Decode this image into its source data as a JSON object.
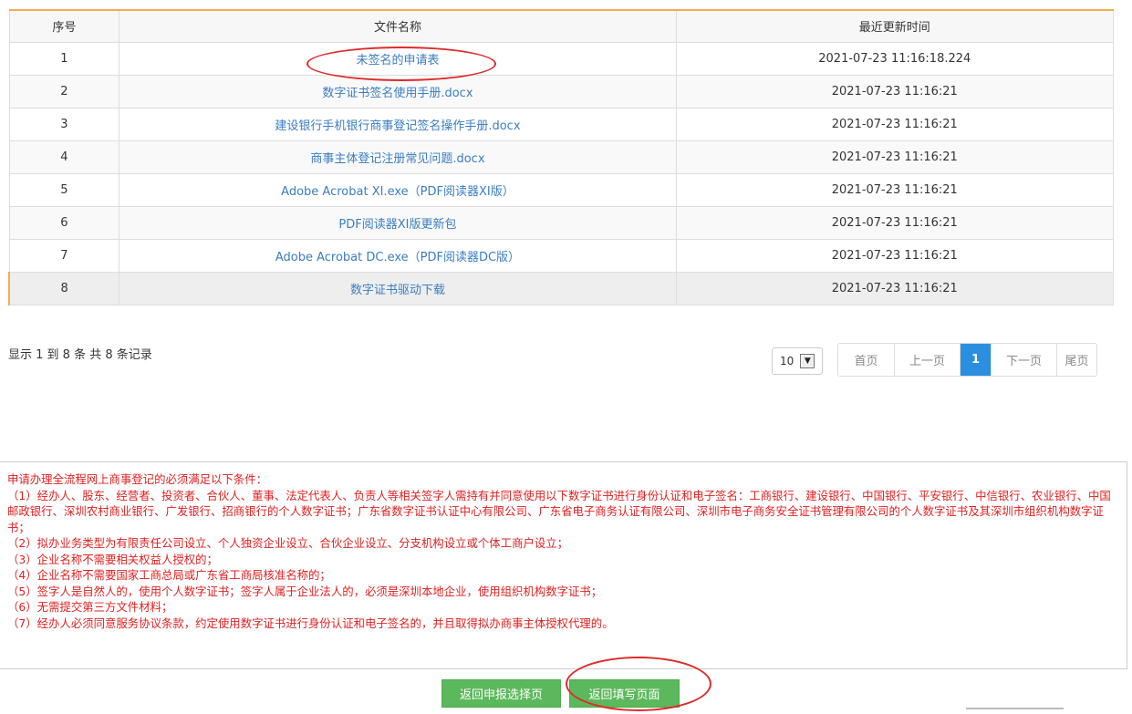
{
  "table": {
    "headers": [
      "序号",
      "文件名称",
      "最近更新时间"
    ],
    "rows": [
      {
        "index": "1",
        "name": "未签名的申请表",
        "time": "2021-07-23 11:16:18.224"
      },
      {
        "index": "2",
        "name": "数字证书签名使用手册.docx",
        "time": "2021-07-23 11:16:21"
      },
      {
        "index": "3",
        "name": "建设银行手机银行商事登记签名操作手册.docx",
        "time": "2021-07-23 11:16:21"
      },
      {
        "index": "4",
        "name": "商事主体登记注册常见问题.docx",
        "time": "2021-07-23 11:16:21"
      },
      {
        "index": "5",
        "name": "Adobe Acrobat XI.exe（PDF阅读器XI版）",
        "time": "2021-07-23 11:16:21"
      },
      {
        "index": "6",
        "name": "PDF阅读器XI版更新包",
        "time": "2021-07-23 11:16:21"
      },
      {
        "index": "7",
        "name": "Adobe Acrobat DC.exe（PDF阅读器DC版）",
        "time": "2021-07-23 11:16:21"
      },
      {
        "index": "8",
        "name": "数字证书驱动下载",
        "time": "2021-07-23 11:16:21"
      }
    ]
  },
  "pagination": {
    "info": "显示 1 到 8 条 共 8 条记录",
    "page_size": "10",
    "first": "首页",
    "prev": "上一页",
    "current": "1",
    "next": "下一页",
    "last": "尾页"
  },
  "notice": {
    "lines": [
      "申请办理全流程网上商事登记的必须满足以下条件：",
      "（1）经办人、股东、经营者、投资者、合伙人、董事、法定代表人、负责人等相关签字人需持有并同意使用以下数字证书进行身份认证和电子签名：工商银行、建设银行、中国银行、平安银行、中信银行、农业银行、中国邮政银行、深圳农村商业银行、广发银行、招商银行的个人数字证书；广东省数字证书认证中心有限公司、广东省电子商务认证有限公司、深圳市电子商务安全证书管理有限公司的个人数字证书及其深圳市组织机构数字证书；",
      "（2）拟办业务类型为有限责任公司设立、个人独资企业设立、合伙企业设立、分支机构设立或个体工商户设立；",
      "（3）企业名称不需要相关权益人授权的；",
      "（4）企业名称不需要国家工商总局或广东省工商局核准名称的；",
      "（5）签字人是自然人的，使用个人数字证书；签字人属于企业法人的，必须是深圳本地企业，使用组织机构数字证书；",
      "（6）无需提交第三方文件材料；",
      "（7）经办人必须同意服务协议条款，约定使用数字证书进行身份认证和电子签名的，并且取得拟办商事主体授权代理的。"
    ]
  },
  "buttons": {
    "back_select": "返回申报选择页",
    "back_fill": "返回填写页面"
  },
  "colors": {
    "link": "#3a7ec0",
    "accent_orange": "#f0ad4e",
    "notice_red": "#e02020",
    "button_green": "#5cb85c",
    "pager_active": "#2b8fe0",
    "annotation_red": "#e02a2a"
  },
  "icons": {
    "page_size_dropdown": "chevron-down-icon"
  }
}
